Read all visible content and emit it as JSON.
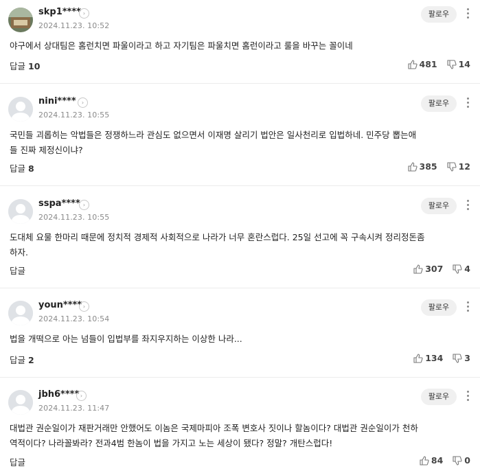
{
  "follow_label": "팔로우",
  "reply_label": "답글",
  "comments": [
    {
      "author": "skp1****",
      "date": "2024.11.23. 10:52",
      "text": "야구에서 상대팀은 홈런치면 파울이라고 하고 자기팀은 파울치면 홈런이라고 룰을 바꾸는 꼴이네",
      "replies": "10",
      "likes": "481",
      "dislikes": "14",
      "avatar": "photo"
    },
    {
      "author": "nini****",
      "date": "2024.11.23. 10:55",
      "text": "국민들 괴롭히는 악법들은 정쟁하느라 관심도 없으면서 이재명 살리기 법안은 일사천리로 입법하네. 민주당 뽑는애\n들 진짜 제정신이냐?",
      "replies": "8",
      "likes": "385",
      "dislikes": "12",
      "avatar": "default"
    },
    {
      "author": "sspa****",
      "date": "2024.11.23. 10:55",
      "text": "도대체 요물 한마리 때문에 정치적 경제적 사회적으로 나라가 너무 혼란스럽다. 25일 선고에 꼭 구속시켜 정리정돈좀\n하자.",
      "replies": "",
      "likes": "307",
      "dislikes": "4",
      "avatar": "default"
    },
    {
      "author": "youn****",
      "date": "2024.11.23. 10:54",
      "text": "법을 개떡으로 아는 넘들이 입법부를 좌지우지하는 이상한 나라...",
      "replies": "2",
      "likes": "134",
      "dislikes": "3",
      "avatar": "default"
    },
    {
      "author": "jbh6****",
      "date": "2024.11.23. 11:47",
      "text": "대법관 권순일이가 재판거래만 안했어도 이놈은 국제마피아 조폭 변호사 짓이나 할놈이다? 대법관 권순일이가 천하\n역적이다? 나라꼴봐라? 전과4범 한놈이 법을 가지고 노는 세상이 됐다? 정말? 개탄스럽다!",
      "replies": "",
      "likes": "84",
      "dislikes": "0",
      "avatar": "default"
    }
  ]
}
